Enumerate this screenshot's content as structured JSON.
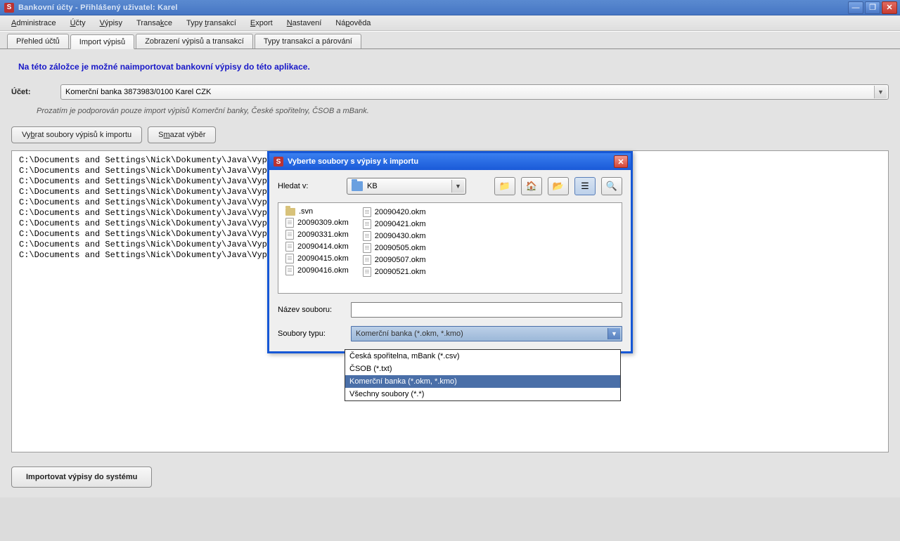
{
  "titlebar": {
    "title": "Bankovní účty  -  Přihlášený uživatel:  Karel"
  },
  "menu": [
    "Administrace",
    "Účty",
    "Výpisy",
    "Transakce",
    "Typy transakcí",
    "Export",
    "Nastavení",
    "Nápověda"
  ],
  "menu_underline_idx": [
    0,
    0,
    0,
    6,
    5,
    0,
    0,
    2
  ],
  "tabs": [
    "Přehled účtů",
    "Import výpisů",
    "Zobrazení výpisů a transakcí",
    "Typy transakcí a párování"
  ],
  "active_tab": 1,
  "page": {
    "heading": "Na této záložce je možné naimportovat bankovní výpisy do této aplikace.",
    "account_label": "Účet:",
    "account_value": "Komerční banka      3873983/0100      Karel      CZK",
    "supported_note": "Prozatím je podporován pouze import výpisů Komerční banky, České spořitelny, ČSOB a mBank.",
    "btn_select_files": "Vybrat soubory výpisů k importu",
    "btn_clear": "Smazat výběr",
    "btn_import": "Importovat výpisy do systému",
    "files": [
      "C:\\Documents and Settings\\Nick\\Dokumenty\\Java\\Vyp:",
      "C:\\Documents and Settings\\Nick\\Dokumenty\\Java\\Vyp:",
      "C:\\Documents and Settings\\Nick\\Dokumenty\\Java\\Vyp:",
      "C:\\Documents and Settings\\Nick\\Dokumenty\\Java\\Vyp:",
      "C:\\Documents and Settings\\Nick\\Dokumenty\\Java\\Vyp:",
      "C:\\Documents and Settings\\Nick\\Dokumenty\\Java\\Vyp:",
      "C:\\Documents and Settings\\Nick\\Dokumenty\\Java\\Vyp:",
      "C:\\Documents and Settings\\Nick\\Dokumenty\\Java\\Vyp:",
      "C:\\Documents and Settings\\Nick\\Dokumenty\\Java\\Vyp:",
      "C:\\Documents and Settings\\Nick\\Dokumenty\\Java\\Vyp:"
    ]
  },
  "dialog": {
    "title": "Vyberte soubory s výpisy k importu",
    "lookin_label": "Hledat v:",
    "lookin_value": "KB",
    "filename_label": "Název souboru:",
    "filetype_label": "Soubory typu:",
    "filetype_value": "Komerční banka (*.okm, *.kmo)",
    "col1": [
      ".svn",
      "20090309.okm",
      "20090331.okm",
      "20090414.okm",
      "20090415.okm",
      "20090416.okm"
    ],
    "col2": [
      "20090420.okm",
      "20090421.okm",
      "20090430.okm",
      "20090505.okm",
      "20090507.okm",
      "20090521.okm"
    ],
    "options": [
      "Česká spořitelna, mBank (*.csv)",
      "ČSOB (*.txt)",
      "Komerční banka (*.okm, *.kmo)",
      "Všechny soubory (*.*)"
    ],
    "selected_option": 2,
    "icons": [
      "folder-up",
      "home",
      "new-folder",
      "list-view",
      "details-view"
    ]
  }
}
